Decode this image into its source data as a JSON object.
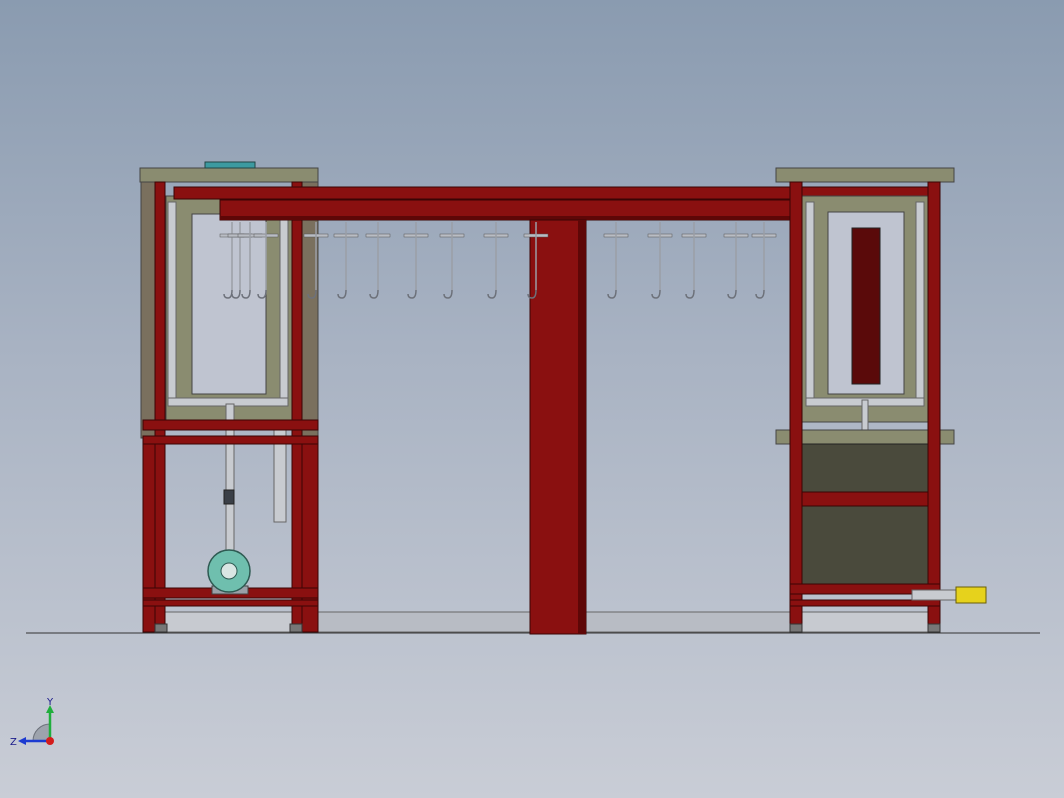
{
  "viewport": {
    "background_top": "#8a9bb0",
    "background_bottom": "#c9cdd6"
  },
  "colors": {
    "frame_red": "#8a1010",
    "frame_red_dark": "#5e0707",
    "panel_olive": "#8a8c70",
    "panel_olive_light": "#b3b49a",
    "tank_dark": "#4a4a3c",
    "pipe_gray": "#c8cbd0",
    "hook_gray": "#9a9ea6",
    "motor_teal": "#6fbfae",
    "nozzle_yellow": "#e6d21c",
    "base_steel": "#b8bcc4"
  },
  "triad": {
    "x_label": "",
    "y_label": "Y",
    "z_label": "Z"
  }
}
